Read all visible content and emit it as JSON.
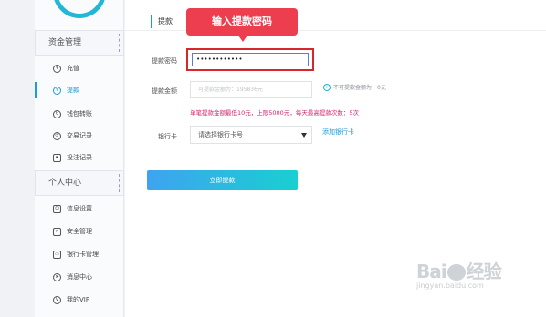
{
  "sidebar": {
    "sections": [
      {
        "header": "资金管理",
        "items": [
          {
            "label": "充值",
            "icon": "deposit-icon",
            "glyph": "¥",
            "active": false
          },
          {
            "label": "提款",
            "icon": "withdraw-icon",
            "glyph": "¥",
            "active": true
          },
          {
            "label": "钱包转账",
            "icon": "wallet-icon",
            "glyph": "↻",
            "active": false
          },
          {
            "label": "交易记录",
            "icon": "transaction-icon",
            "glyph": "⟳",
            "active": false
          },
          {
            "label": "投注记录",
            "icon": "bet-record-icon",
            "glyph": "▪",
            "active": false
          }
        ]
      },
      {
        "header": "个人中心",
        "items": [
          {
            "label": "信息设置",
            "icon": "info-icon",
            "glyph": "☺"
          },
          {
            "label": "安全管理",
            "icon": "shield-icon",
            "glyph": "✓"
          },
          {
            "label": "银行卡管理",
            "icon": "bank-card-icon",
            "glyph": "▭"
          },
          {
            "label": "消息中心",
            "icon": "message-icon",
            "glyph": "➤"
          },
          {
            "label": "我的VIP",
            "icon": "vip-icon",
            "glyph": "V"
          }
        ]
      }
    ]
  },
  "main": {
    "tab_label": "提款",
    "tooltip": "输入提款密码",
    "form": {
      "password_label": "提款密码",
      "password_value": "••••••••••••",
      "amount_label": "提款金额",
      "amount_placeholder": "可提款金额为：195836元",
      "hint": "不可提款金额为：0元",
      "warning": "单笔提款金额最低10元，上限5000元，每天最高提款次数：5次",
      "bank_label": "银行卡",
      "bank_select": "请选择银行卡号",
      "add_bank": "添加银行卡",
      "submit": "立即提款"
    }
  },
  "watermark": {
    "brand_left": "Bai",
    "brand_right": "经验",
    "url": "jingyan.baidu.com"
  },
  "colors": {
    "accent": "#1c9bd8",
    "tooltip": "#ec3e4e",
    "highlight_border": "#d9262d",
    "warning": "#d6246e",
    "button_start": "#3fa3f0",
    "button_end": "#19cfd1"
  }
}
